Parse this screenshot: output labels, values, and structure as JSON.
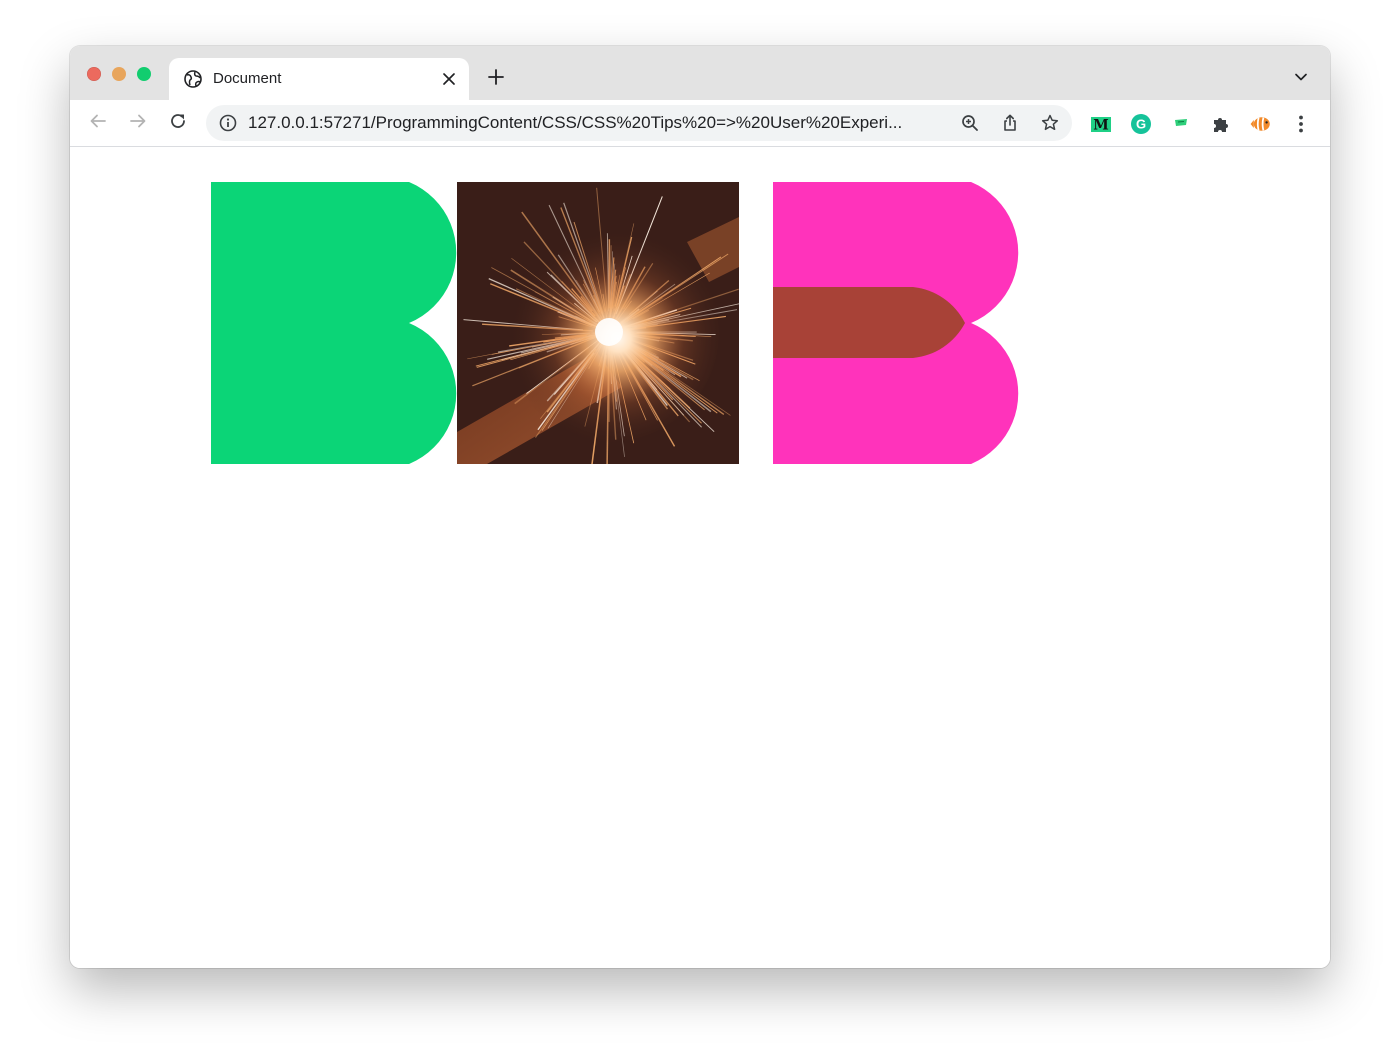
{
  "window": {
    "traffic_lights": [
      "close",
      "minimize",
      "zoom"
    ]
  },
  "tab": {
    "title": "Document",
    "favicon": "globe-icon",
    "close_icon": "close-icon"
  },
  "toolbar": {
    "back_icon": "arrow-left-icon",
    "forward_icon": "arrow-right-icon",
    "reload_icon": "reload-icon",
    "url": "127.0.0.1:57271/ProgrammingContent/CSS/CSS%20Tips%20=>%20User%20Experi...",
    "info_icon": "info-icon",
    "zoom_icon": "zoom-icon",
    "share_icon": "share-icon",
    "bookmark_icon": "star-icon"
  },
  "extensions": [
    {
      "name": "medium-extension-icon",
      "label": "M"
    },
    {
      "name": "grammarly-extension-icon",
      "label": "G"
    },
    {
      "name": "flag-extension-icon"
    },
    {
      "name": "puzzle-extensions-icon"
    },
    {
      "name": "fish-extension-icon"
    },
    {
      "name": "menu-kebab-icon"
    }
  ],
  "colors": {
    "green_shape": "#0bd577",
    "pink_shape": "#ff33bb",
    "blend_overlap": "#a84237",
    "sparkler_bg": "#3a1e18",
    "spark": "#f0a868",
    "spark_hot": "#fff3e6"
  }
}
